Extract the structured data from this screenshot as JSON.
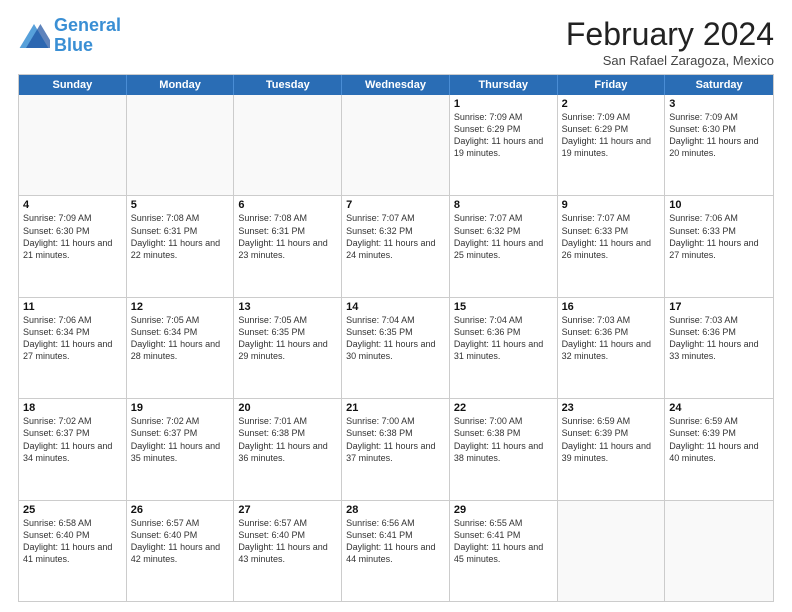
{
  "header": {
    "logo_line1": "General",
    "logo_line2": "Blue",
    "title": "February 2024",
    "subtitle": "San Rafael Zaragoza, Mexico"
  },
  "weekdays": [
    "Sunday",
    "Monday",
    "Tuesday",
    "Wednesday",
    "Thursday",
    "Friday",
    "Saturday"
  ],
  "weeks": [
    [
      {
        "day": "",
        "text": ""
      },
      {
        "day": "",
        "text": ""
      },
      {
        "day": "",
        "text": ""
      },
      {
        "day": "",
        "text": ""
      },
      {
        "day": "1",
        "text": "Sunrise: 7:09 AM\nSunset: 6:29 PM\nDaylight: 11 hours and 19 minutes."
      },
      {
        "day": "2",
        "text": "Sunrise: 7:09 AM\nSunset: 6:29 PM\nDaylight: 11 hours and 19 minutes."
      },
      {
        "day": "3",
        "text": "Sunrise: 7:09 AM\nSunset: 6:30 PM\nDaylight: 11 hours and 20 minutes."
      }
    ],
    [
      {
        "day": "4",
        "text": "Sunrise: 7:09 AM\nSunset: 6:30 PM\nDaylight: 11 hours and 21 minutes."
      },
      {
        "day": "5",
        "text": "Sunrise: 7:08 AM\nSunset: 6:31 PM\nDaylight: 11 hours and 22 minutes."
      },
      {
        "day": "6",
        "text": "Sunrise: 7:08 AM\nSunset: 6:31 PM\nDaylight: 11 hours and 23 minutes."
      },
      {
        "day": "7",
        "text": "Sunrise: 7:07 AM\nSunset: 6:32 PM\nDaylight: 11 hours and 24 minutes."
      },
      {
        "day": "8",
        "text": "Sunrise: 7:07 AM\nSunset: 6:32 PM\nDaylight: 11 hours and 25 minutes."
      },
      {
        "day": "9",
        "text": "Sunrise: 7:07 AM\nSunset: 6:33 PM\nDaylight: 11 hours and 26 minutes."
      },
      {
        "day": "10",
        "text": "Sunrise: 7:06 AM\nSunset: 6:33 PM\nDaylight: 11 hours and 27 minutes."
      }
    ],
    [
      {
        "day": "11",
        "text": "Sunrise: 7:06 AM\nSunset: 6:34 PM\nDaylight: 11 hours and 27 minutes."
      },
      {
        "day": "12",
        "text": "Sunrise: 7:05 AM\nSunset: 6:34 PM\nDaylight: 11 hours and 28 minutes."
      },
      {
        "day": "13",
        "text": "Sunrise: 7:05 AM\nSunset: 6:35 PM\nDaylight: 11 hours and 29 minutes."
      },
      {
        "day": "14",
        "text": "Sunrise: 7:04 AM\nSunset: 6:35 PM\nDaylight: 11 hours and 30 minutes."
      },
      {
        "day": "15",
        "text": "Sunrise: 7:04 AM\nSunset: 6:36 PM\nDaylight: 11 hours and 31 minutes."
      },
      {
        "day": "16",
        "text": "Sunrise: 7:03 AM\nSunset: 6:36 PM\nDaylight: 11 hours and 32 minutes."
      },
      {
        "day": "17",
        "text": "Sunrise: 7:03 AM\nSunset: 6:36 PM\nDaylight: 11 hours and 33 minutes."
      }
    ],
    [
      {
        "day": "18",
        "text": "Sunrise: 7:02 AM\nSunset: 6:37 PM\nDaylight: 11 hours and 34 minutes."
      },
      {
        "day": "19",
        "text": "Sunrise: 7:02 AM\nSunset: 6:37 PM\nDaylight: 11 hours and 35 minutes."
      },
      {
        "day": "20",
        "text": "Sunrise: 7:01 AM\nSunset: 6:38 PM\nDaylight: 11 hours and 36 minutes."
      },
      {
        "day": "21",
        "text": "Sunrise: 7:00 AM\nSunset: 6:38 PM\nDaylight: 11 hours and 37 minutes."
      },
      {
        "day": "22",
        "text": "Sunrise: 7:00 AM\nSunset: 6:38 PM\nDaylight: 11 hours and 38 minutes."
      },
      {
        "day": "23",
        "text": "Sunrise: 6:59 AM\nSunset: 6:39 PM\nDaylight: 11 hours and 39 minutes."
      },
      {
        "day": "24",
        "text": "Sunrise: 6:59 AM\nSunset: 6:39 PM\nDaylight: 11 hours and 40 minutes."
      }
    ],
    [
      {
        "day": "25",
        "text": "Sunrise: 6:58 AM\nSunset: 6:40 PM\nDaylight: 11 hours and 41 minutes."
      },
      {
        "day": "26",
        "text": "Sunrise: 6:57 AM\nSunset: 6:40 PM\nDaylight: 11 hours and 42 minutes."
      },
      {
        "day": "27",
        "text": "Sunrise: 6:57 AM\nSunset: 6:40 PM\nDaylight: 11 hours and 43 minutes."
      },
      {
        "day": "28",
        "text": "Sunrise: 6:56 AM\nSunset: 6:41 PM\nDaylight: 11 hours and 44 minutes."
      },
      {
        "day": "29",
        "text": "Sunrise: 6:55 AM\nSunset: 6:41 PM\nDaylight: 11 hours and 45 minutes."
      },
      {
        "day": "",
        "text": ""
      },
      {
        "day": "",
        "text": ""
      }
    ]
  ]
}
